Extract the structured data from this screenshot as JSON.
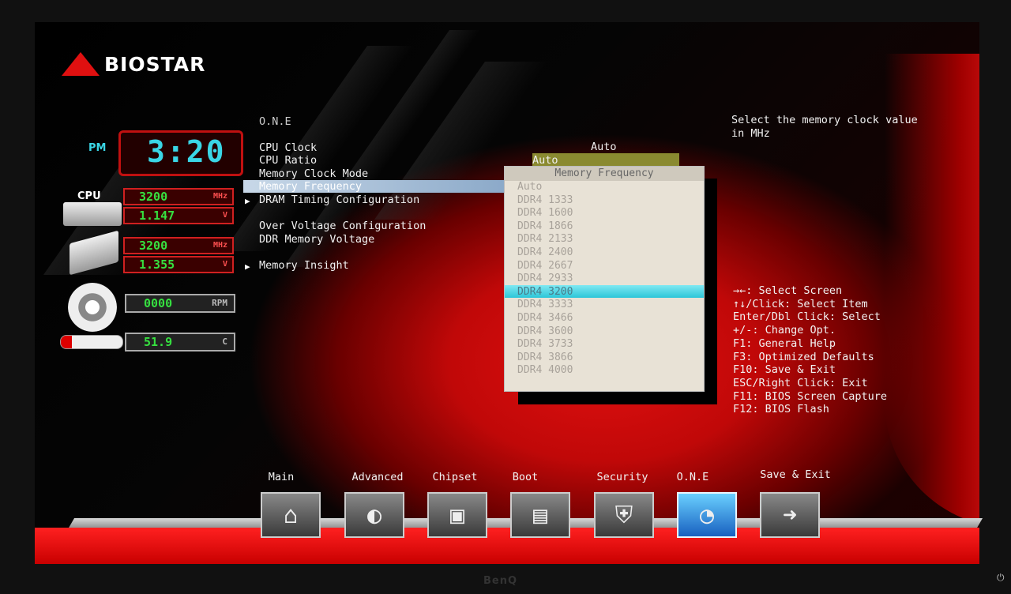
{
  "brand": {
    "logo_text": "BIOSTAR",
    "monitor_brand": "BenQ"
  },
  "gadgets": {
    "clock": {
      "ampm": "PM",
      "time": "3:20"
    },
    "cpu_label": "CPU",
    "cpu_freq": "3200",
    "cpu_freq_unit": "MHz",
    "cpu_volt": "1.147",
    "cpu_volt_unit": "V",
    "mem_freq": "3200",
    "mem_freq_unit": "MHz",
    "mem_volt": "1.355",
    "mem_volt_unit": "V",
    "fan_rpm": "0000",
    "fan_unit": "RPM",
    "temp": "51.9",
    "temp_unit": "C"
  },
  "menu": {
    "section": "O.N.E",
    "cpu_clock": "CPU Clock",
    "cpu_ratio": "CPU Ratio",
    "mem_clock_mode": "Memory Clock Mode",
    "mem_frequency": "Memory Frequency",
    "dram_timing": "DRAM Timing Configuration",
    "over_voltage": "Over Voltage Configuration",
    "ddr_voltage": "DDR Memory Voltage",
    "memory_insight": "Memory Insight",
    "cpu_clock_value": "Auto",
    "cpu_ratio_value": "Auto"
  },
  "popup": {
    "title": "Memory Frequency",
    "options": [
      "Auto",
      "DDR4 1333",
      "DDR4 1600",
      "DDR4 1866",
      "DDR4 2133",
      "DDR4 2400",
      "DDR4 2667",
      "DDR4 2933",
      "DDR4 3200",
      "DDR4 3333",
      "DDR4 3466",
      "DDR4 3600",
      "DDR4 3733",
      "DDR4 3866",
      "DDR4 4000"
    ],
    "selected": "DDR4 3200"
  },
  "help": {
    "description": "Select the memory clock value\nin MHz",
    "keys": [
      "→←: Select Screen",
      "↑↓/Click: Select Item",
      "Enter/Dbl Click: Select",
      "+/-: Change Opt.",
      "F1: General Help",
      "F3: Optimized Defaults",
      "F10: Save & Exit",
      "ESC/Right Click: Exit",
      "F11: BIOS Screen Capture",
      "F12: BIOS Flash"
    ]
  },
  "nav": {
    "tabs": [
      {
        "label": "Main",
        "icon": "home-icon"
      },
      {
        "label": "Advanced",
        "icon": "advanced-icon"
      },
      {
        "label": "Chipset",
        "icon": "chipset-icon"
      },
      {
        "label": "Boot",
        "icon": "boot-icon"
      },
      {
        "label": "Security",
        "icon": "security-icon"
      },
      {
        "label": "O.N.E",
        "icon": "one-icon"
      },
      {
        "label": "Save & Exit",
        "icon": "save-exit-icon"
      }
    ],
    "active": "O.N.E"
  }
}
